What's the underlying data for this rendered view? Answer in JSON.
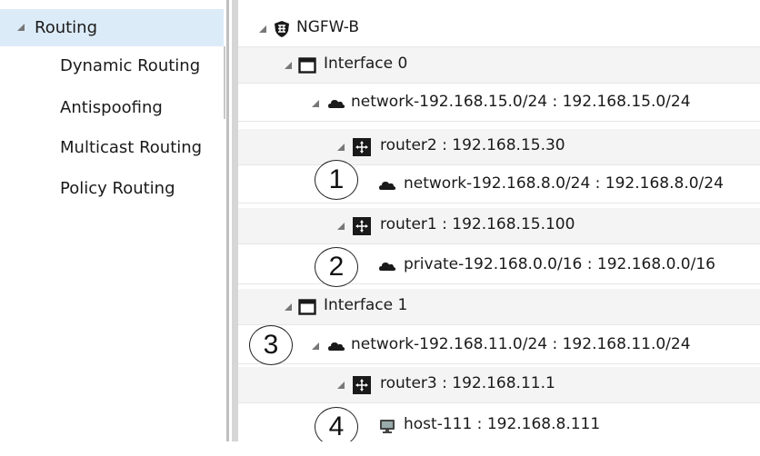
{
  "nav": {
    "parent": "Routing",
    "items": [
      "Dynamic Routing",
      "Antispoofing",
      "Multicast Routing",
      "Policy Routing"
    ]
  },
  "tree": {
    "root": "NGFW-B",
    "interface0": {
      "label": "Interface 0",
      "network": "network-192.168.15.0/24 : 192.168.15.0/24",
      "router2": "router2 : 192.168.15.30",
      "router2_child": "network-192.168.8.0/24 : 192.168.8.0/24",
      "router1": "router1 : 192.168.15.100",
      "router1_child": "private-192.168.0.0/16 : 192.168.0.0/16"
    },
    "interface1": {
      "label": "Interface 1",
      "network": "network-192.168.11.0/24 : 192.168.11.0/24",
      "router3": "router3 : 192.168.11.1",
      "router3_child": "host-111 : 192.168.8.111"
    }
  },
  "callouts": [
    "1",
    "2",
    "3",
    "4"
  ],
  "colors": {
    "selected_bg": "#dcebf8",
    "alt_row": "#f4f4f4",
    "splitter": "#d6d6d6"
  }
}
